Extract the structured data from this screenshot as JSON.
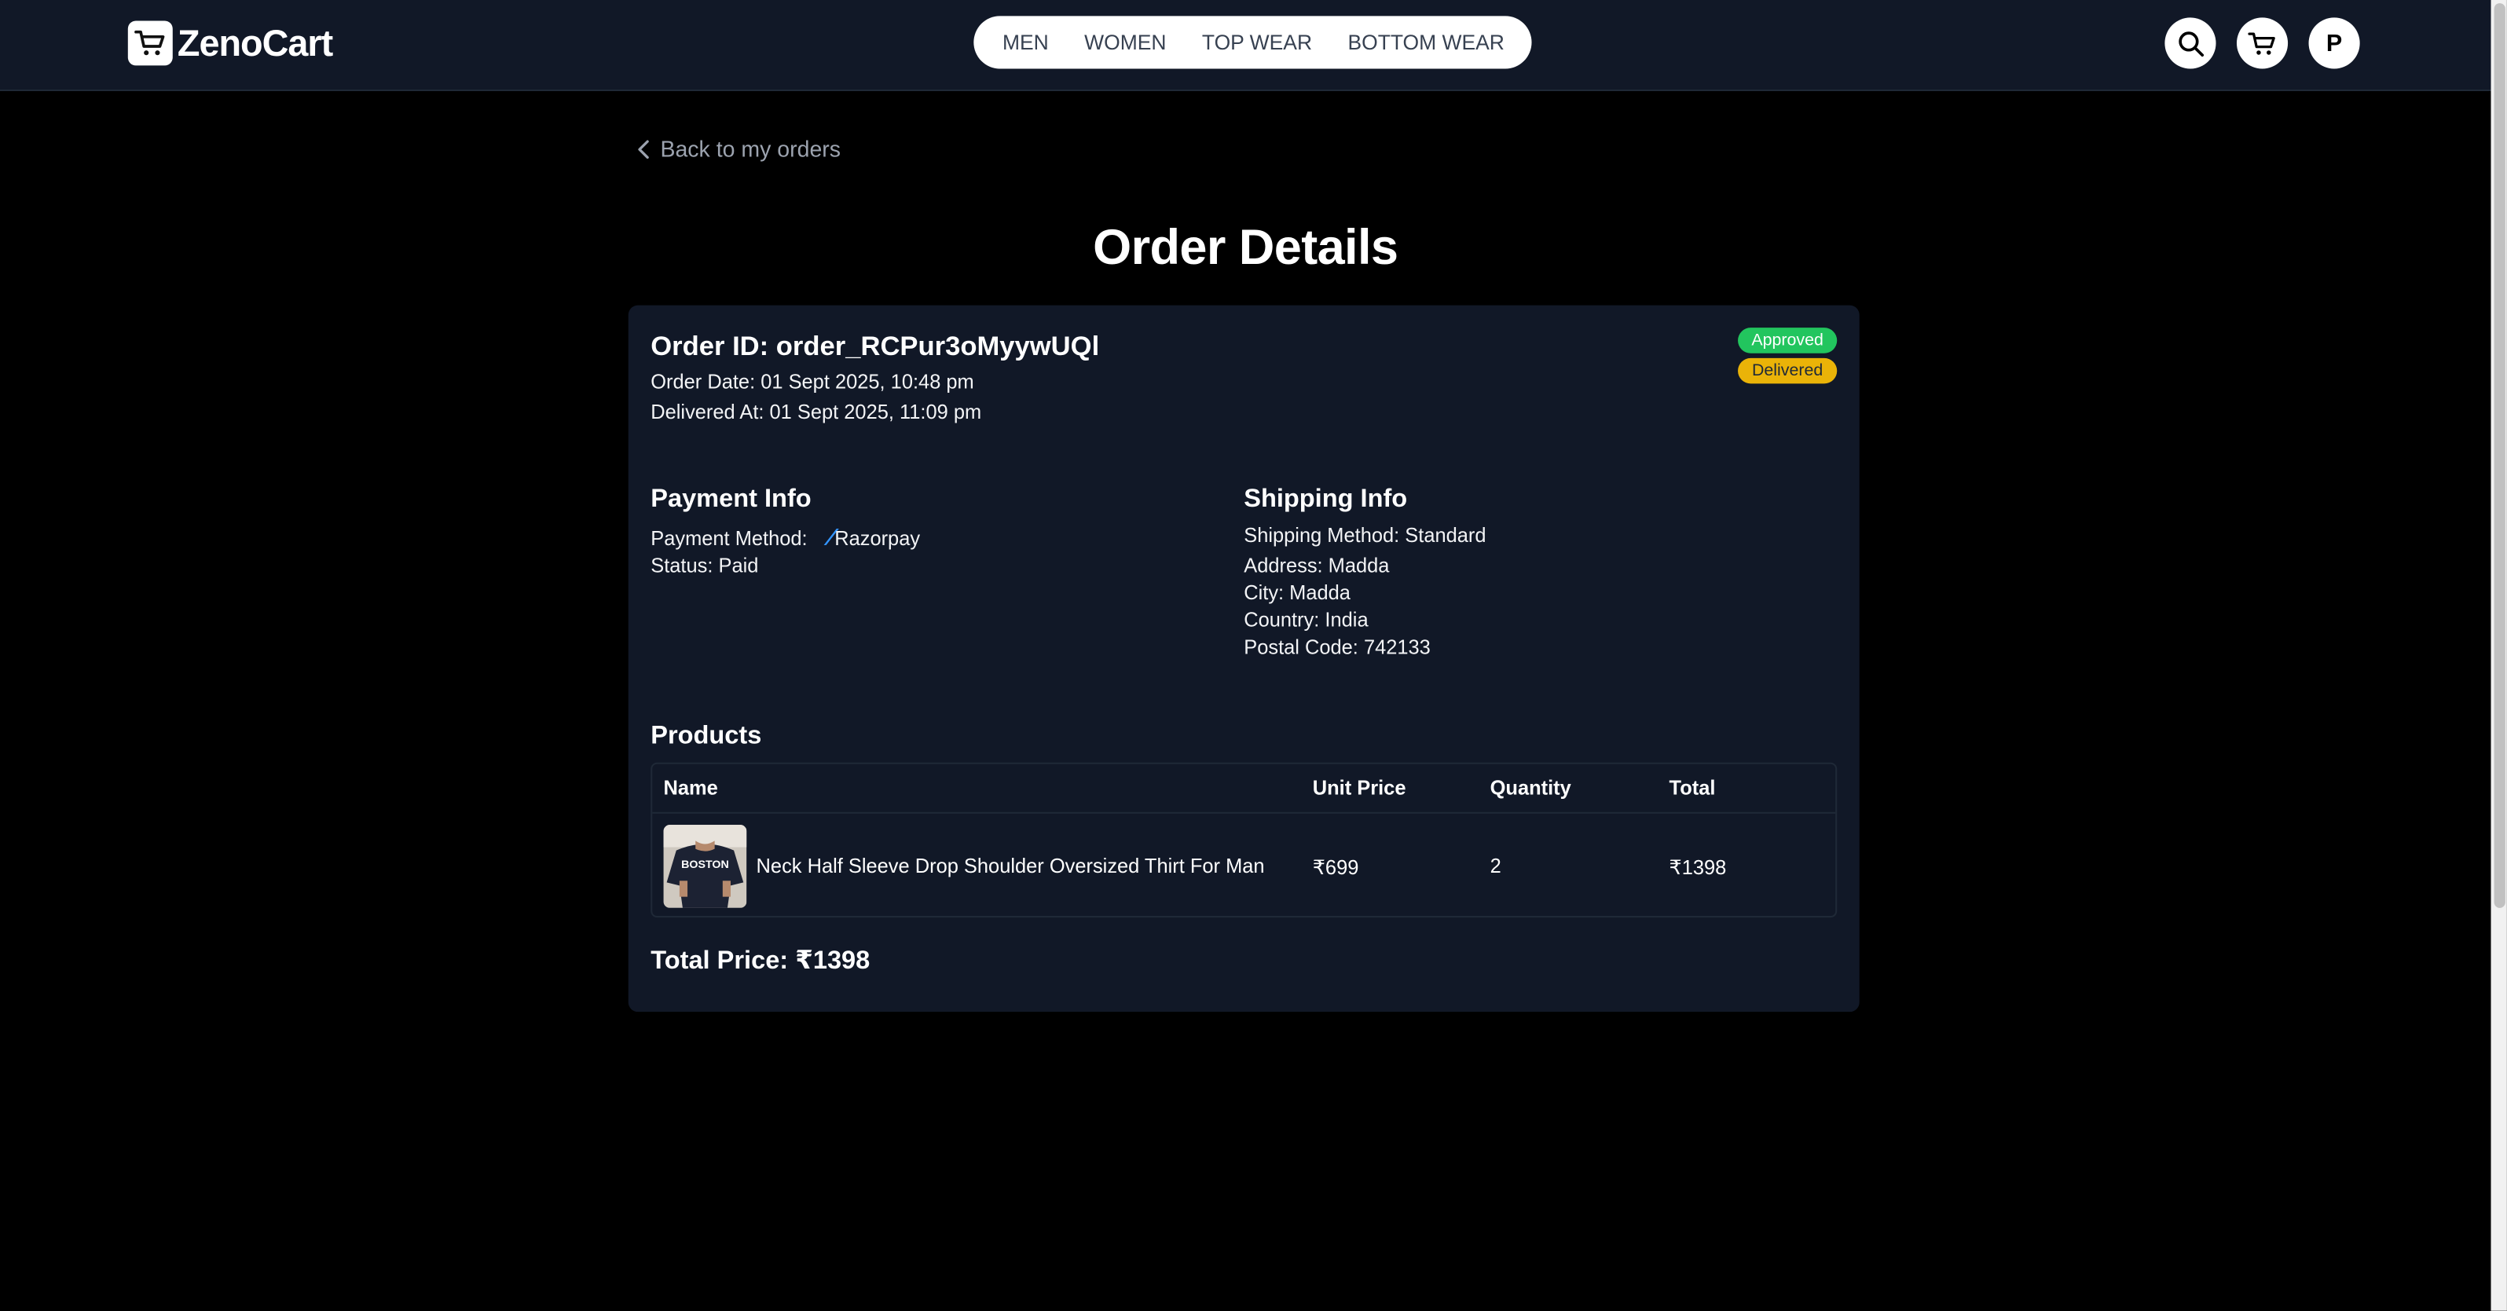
{
  "brand": {
    "name": "ZenoCart"
  },
  "nav": {
    "links": [
      "MEN",
      "WOMEN",
      "TOP WEAR",
      "BOTTOM WEAR"
    ],
    "profile_initial": "P"
  },
  "back_link": "Back to my orders",
  "page_title": "Order Details",
  "order": {
    "id_line": "Order ID: order_RCPur3oMyywUQl",
    "date_line": "Order Date: 01 Sept 2025, 10:48 pm",
    "delivered_line": "Delivered At: 01 Sept 2025, 11:09 pm",
    "badges": {
      "approved": "Approved",
      "delivered": "Delivered"
    }
  },
  "payment": {
    "title": "Payment Info",
    "method_label": "Payment Method:",
    "method_value": "Razorpay",
    "status_line": "Status: Paid"
  },
  "shipping": {
    "title": "Shipping Info",
    "method_line": "Shipping Method: Standard",
    "address_line": "Address: Madda",
    "city_line": "City: Madda",
    "country_line": "Country: India",
    "postal_line": "Postal Code: 742133"
  },
  "products": {
    "title": "Products",
    "columns": [
      "Name",
      "Unit Price",
      "Quantity",
      "Total"
    ],
    "rows": [
      {
        "name": "Neck Half Sleeve Drop Shoulder Oversized Thirt For Man",
        "unit_price": "₹699",
        "quantity": "2",
        "total": "₹1398",
        "image_text": "BOSTON"
      }
    ]
  },
  "total_price": "Total Price: ₹1398",
  "colors": {
    "navbar_bg": "#111827",
    "card_bg": "#111827",
    "approved": "#22c55e",
    "delivered": "#eab308",
    "razorpay": "#3395ff"
  }
}
